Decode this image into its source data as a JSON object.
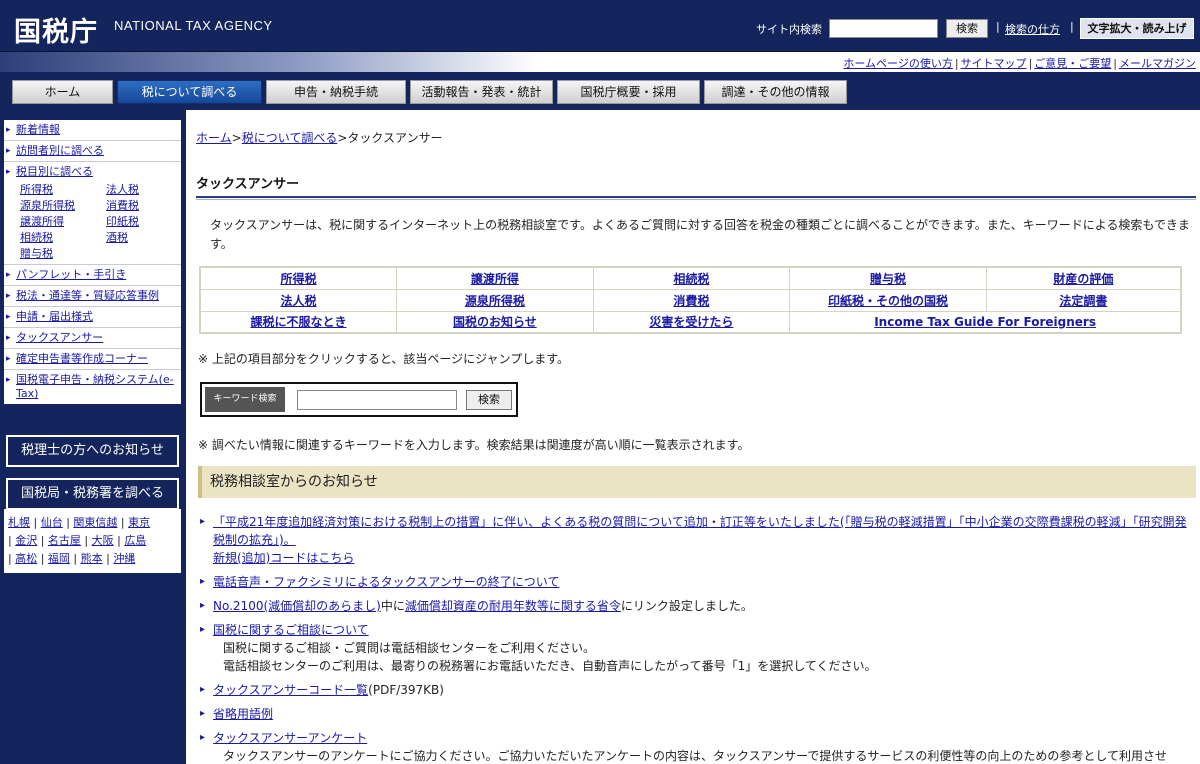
{
  "header": {
    "logo": "国税庁",
    "logo_en": "NATIONAL TAX AGENCY",
    "search_label": "サイト内検索",
    "search_button": "検索",
    "search_help": "検索の仕方",
    "zoom_button": "文字拡大・読み上げ"
  },
  "util_links": [
    "ホームページの使い方",
    "サイトマップ",
    "ご意見・ご要望",
    "メールマガジン"
  ],
  "nav": [
    "ホーム",
    "税について調べる",
    "申告・納税手続",
    "活動報告・発表・統計",
    "国税庁概要・採用",
    "調達・その他の情報"
  ],
  "sidebar": {
    "items_top": [
      "新着情報",
      "訪問者別に調べる",
      "税目別に調べる"
    ],
    "tax_links": [
      "所得税",
      "法人税",
      "源泉所得税",
      "消費税",
      "譲渡所得",
      "印紙税",
      "相続税",
      "酒税",
      "贈与税"
    ],
    "items_bottom": [
      "パンフレット・手引き",
      "税法・通達等・質疑応答事例",
      "申請・届出様式",
      "タックスアンサー",
      "確定申告書等作成コーナー",
      "国税電子申告・納税システム(e-Tax)"
    ],
    "box_zeirishi": "税理士の方へのお知らせ",
    "box_kyoku": "国税局・税務署を調べる",
    "regions": [
      "札幌",
      "仙台",
      "関東信越",
      "東京",
      "金沢",
      "名古屋",
      "大阪",
      "広島",
      "高松",
      "福岡",
      "熊本",
      "沖縄"
    ]
  },
  "main": {
    "breadcrumb": [
      "ホーム",
      "税について調べる",
      "タックスアンサー"
    ],
    "title": "タックスアンサー",
    "intro": "タックスアンサーは、税に関するインターネット上の税務相談室です。よくあるご質問に対する回答を税金の種類ごとに調べることができます。また、キーワードによる検索もできます。",
    "tax_table": [
      [
        "所得税",
        "譲渡所得",
        "相続税",
        "贈与税",
        "財産の評価"
      ],
      [
        "法人税",
        "源泉所得税",
        "消費税",
        "印紙税・その他の国税",
        "法定調書"
      ],
      [
        "課税に不服なとき",
        "国税のお知らせ",
        "災害を受けたら",
        "Income Tax Guide For Foreigners"
      ]
    ],
    "note_jump": "※  上記の項目部分をクリックすると、該当ページにジャンプします。",
    "keyword_label": "キーワード検索",
    "keyword_button": "検索",
    "note_keyword": "※  調べたい情報に関連するキーワードを入力します。検索結果は関連度が高い順に一覧表示されます。",
    "news_heading": "税務相談室からのお知らせ",
    "news": [
      {
        "link": "「平成21年度追加経済対策における税制上の措置」に伴い、よくある税の質問について追加・訂正等をいたしました(「贈与税の軽減措置」「中小企業の交際費課税の軽減」「研究開発税制の拡充」)。",
        "sub_link": "新規(追加)コードはこちら"
      },
      {
        "link": "電話音声・ファクシミリによるタックスアンサーの終了について"
      },
      {
        "pre": "No.2100(減価償却のあらまし)",
        "mid": "中に",
        "link": "減価償却資産の耐用年数等に関する省令",
        "post": "にリンク設定しました。"
      },
      {
        "link": "国税に関するご相談について",
        "lines": [
          "国税に関するご相談・ご質問は電話相談センターをご利用ください。",
          "電話相談センターのご利用は、最寄りの税務署にお電話いただき、自動音声にしたがって番号「1」を選択してください。"
        ]
      },
      {
        "link": "タックスアンサーコード一覧",
        "post": "(PDF/397KB)"
      },
      {
        "link": "省略用語例"
      },
      {
        "link": "タックスアンサーアンケート",
        "lines": [
          "タックスアンサーのアンケートにご協力ください。ご協力いただいたアンケートの内容は、タックスアンサーで提供するサービスの利便性等の向上のための参考として利用させ"
        ]
      }
    ]
  }
}
